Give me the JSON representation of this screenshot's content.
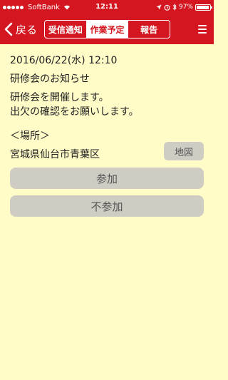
{
  "status_bar": {
    "carrier": "SoftBank",
    "time": "12:11",
    "battery_percent": "97%"
  },
  "nav": {
    "back_label": "戻る",
    "tabs": [
      {
        "label": "受信通知",
        "active": false
      },
      {
        "label": "作業予定",
        "active": true
      },
      {
        "label": "報告",
        "active": false
      }
    ]
  },
  "notice": {
    "datetime": "2016/06/22(水) 12:10",
    "subject": "研修会のお知らせ",
    "body_lines": [
      "研修会を開催します。",
      "出欠の確認をお願いします。"
    ],
    "place_header": "＜場所＞",
    "place": "宮城県仙台市青葉区"
  },
  "buttons": {
    "map": "地図",
    "attend": "参加",
    "decline": "不参加"
  },
  "colors": {
    "header_red": "#d3161f",
    "background": "#fffcc8",
    "button_gray": "#cfccc4"
  }
}
